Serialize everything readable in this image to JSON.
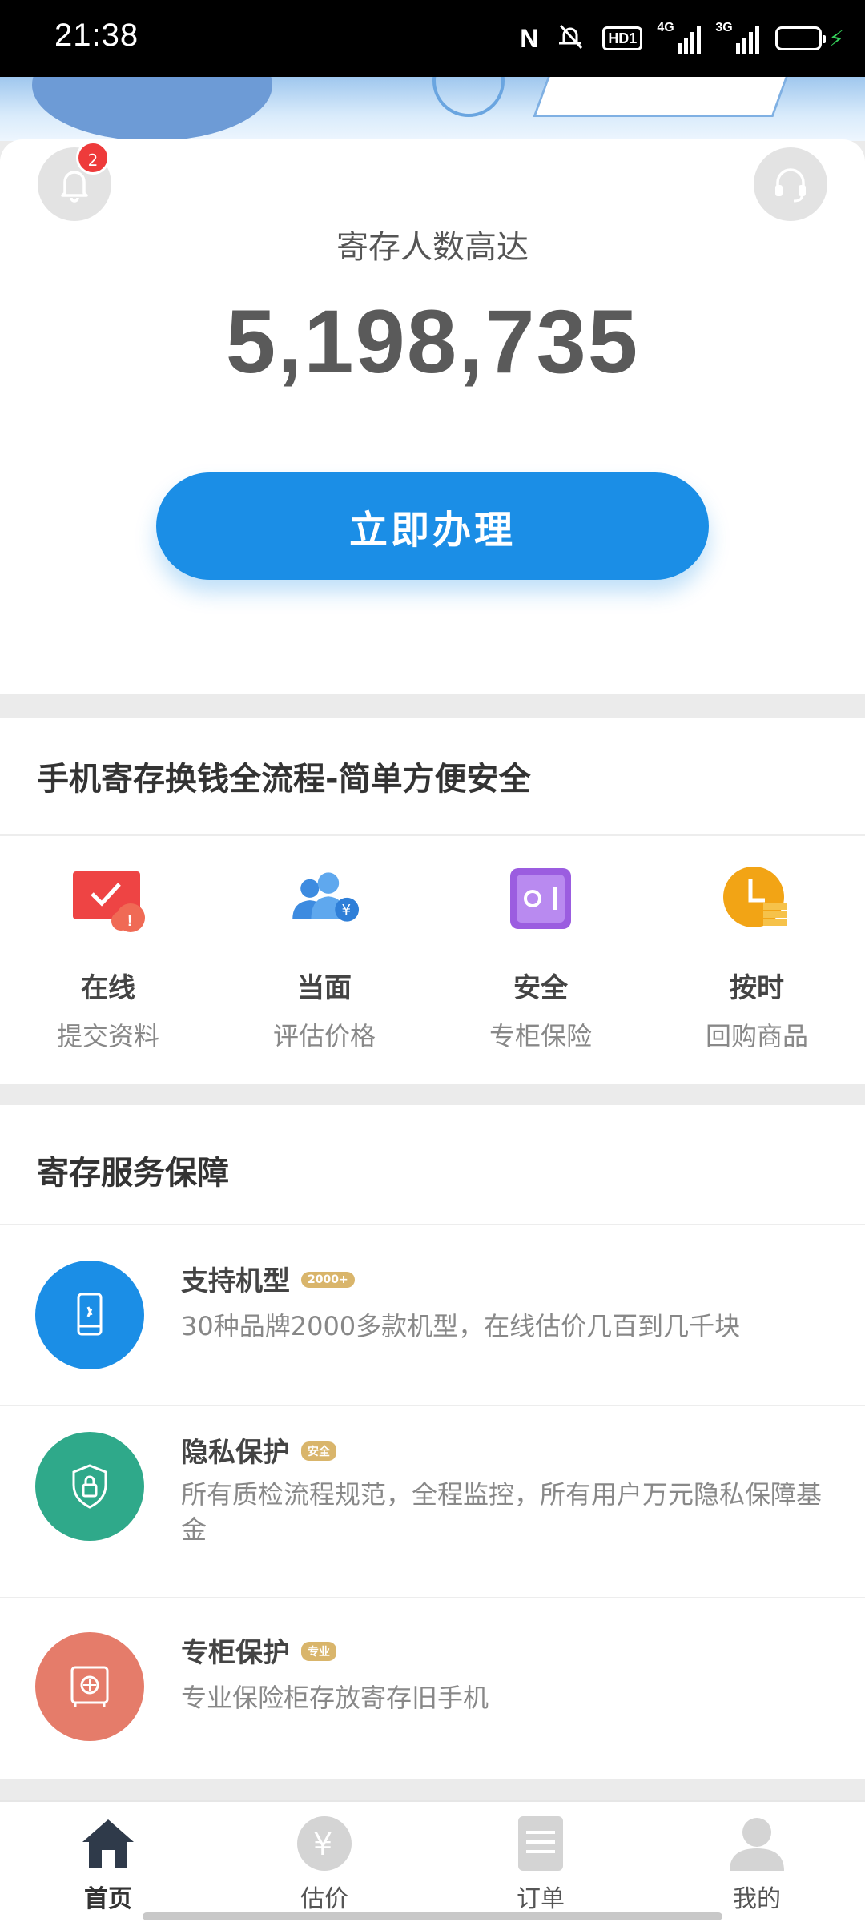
{
  "status_bar": {
    "time": "21:38",
    "network_1": "4G",
    "network_2": "3G",
    "hd_label": "HD1",
    "nfc_label": "N",
    "battery_color": "#35d05a"
  },
  "header": {
    "notification_badge": "2",
    "icons": [
      "bell-icon",
      "headset-icon"
    ]
  },
  "hero": {
    "stat_label": "寄存人数高达",
    "stat_value": "5,198,735",
    "cta_label": "立即办理",
    "cta_color": "#1b8ee6"
  },
  "process": {
    "title": "手机寄存换钱全流程-简单方便安全",
    "steps": [
      {
        "title": "在线",
        "subtitle": "提交资料",
        "icon": "online-submit-icon"
      },
      {
        "title": "当面",
        "subtitle": "评估价格",
        "icon": "face-evaluate-icon"
      },
      {
        "title": "安全",
        "subtitle": "专柜保险",
        "icon": "safe-box-icon"
      },
      {
        "title": "按时",
        "subtitle": "回购商品",
        "icon": "clock-icon"
      }
    ]
  },
  "guarantee": {
    "title": "寄存服务保障",
    "items": [
      {
        "title": "支持机型",
        "tag": "2000+",
        "desc": "30种品牌2000多款机型，在线估价几百到几千块",
        "color": "#1b8ee6",
        "icon": "phone-icon"
      },
      {
        "title": "隐私保护",
        "tag": "安全",
        "desc": "所有质检流程规范，全程监控，所有用户万元隐私保障基金",
        "color": "#2fa98a",
        "icon": "shield-lock-icon"
      },
      {
        "title": "专柜保护",
        "tag": "专业",
        "desc": "专业保险柜存放寄存旧手机",
        "color": "#e57c6a",
        "icon": "safe-icon"
      }
    ]
  },
  "tabbar": {
    "tabs": [
      {
        "label": "首页",
        "icon": "home-icon"
      },
      {
        "label": "估价",
        "icon": "yen-icon"
      },
      {
        "label": "订单",
        "icon": "order-icon"
      },
      {
        "label": "我的",
        "icon": "user-icon"
      }
    ],
    "active": "首页"
  }
}
